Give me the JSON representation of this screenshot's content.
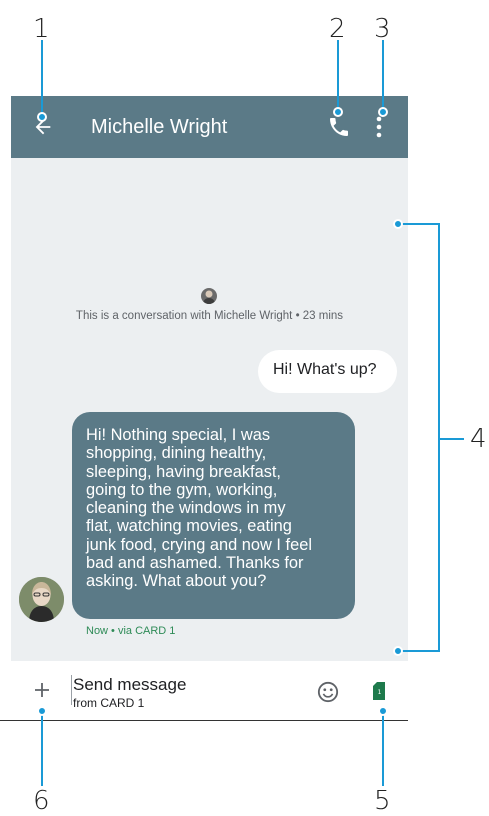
{
  "callouts": [
    "1",
    "2",
    "3",
    "4",
    "5",
    "6"
  ],
  "appbar": {
    "title": "Michelle Wright",
    "icons": {
      "back": "back-arrow-icon",
      "call": "phone-icon",
      "menu": "more-vert-icon"
    }
  },
  "conversation": {
    "info": "This is a conversation with Michelle Wright • 23 mins",
    "outgoing": "Hi! What's up?",
    "incoming_lines": [
      "Hi! Nothing special, I was",
      "shopping, dining healthy,",
      "sleeping,  having breakfast,",
      "going to the gym, working,",
      "cleaning the windows in my",
      "flat, watching movies, eating",
      "junk food, crying and now I feel",
      "bad and ashamed. Thanks for",
      "asking. What about you?"
    ],
    "meta": "Now • via CARD 1"
  },
  "input": {
    "placeholder": "Send message",
    "sub": "from CARD 1",
    "sim_label": "1",
    "icons": {
      "add": "add-icon",
      "emoji": "emoji-icon",
      "sim": "sim-card-icon"
    }
  },
  "colors": {
    "appbar": "#5b7a87",
    "accent": "#1a9ad6",
    "conversation_bg": "#eceff1",
    "sim": "#1e7a4c"
  }
}
